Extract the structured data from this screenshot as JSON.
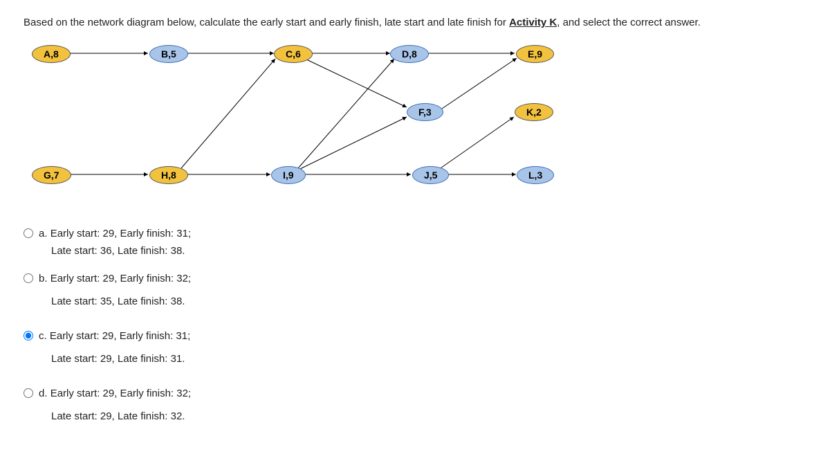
{
  "question": {
    "pre": "Based on the network diagram below, calculate the early start and early finish, late start and late finish for ",
    "activity": "Activity K",
    "post": ", and select the correct answer."
  },
  "nodes": {
    "A": "A,8",
    "B": "B,5",
    "C": "C,6",
    "D": "D,8",
    "E": "E,9",
    "F": "F,3",
    "K": "K,2",
    "G": "G,7",
    "H": "H,8",
    "I": "I,9",
    "J": "J,5",
    "L": "L,3"
  },
  "options": {
    "a": {
      "letter": "a.",
      "line1": "Early start: 29, Early finish: 31;",
      "line2": "Late start: 36, Late finish: 38."
    },
    "b": {
      "letter": "b.",
      "line1": "Early start: 29, Early finish: 32;",
      "line2": "Late start: 35, Late finish: 38."
    },
    "c": {
      "letter": "c.",
      "line1": "Early start: 29, Early finish: 31;",
      "line2": "Late start: 29, Late finish: 31."
    },
    "d": {
      "letter": "d.",
      "line1": "Early start: 29, Early finish: 32;",
      "line2": "Late start: 29, Late finish: 32."
    }
  },
  "selected": "c"
}
